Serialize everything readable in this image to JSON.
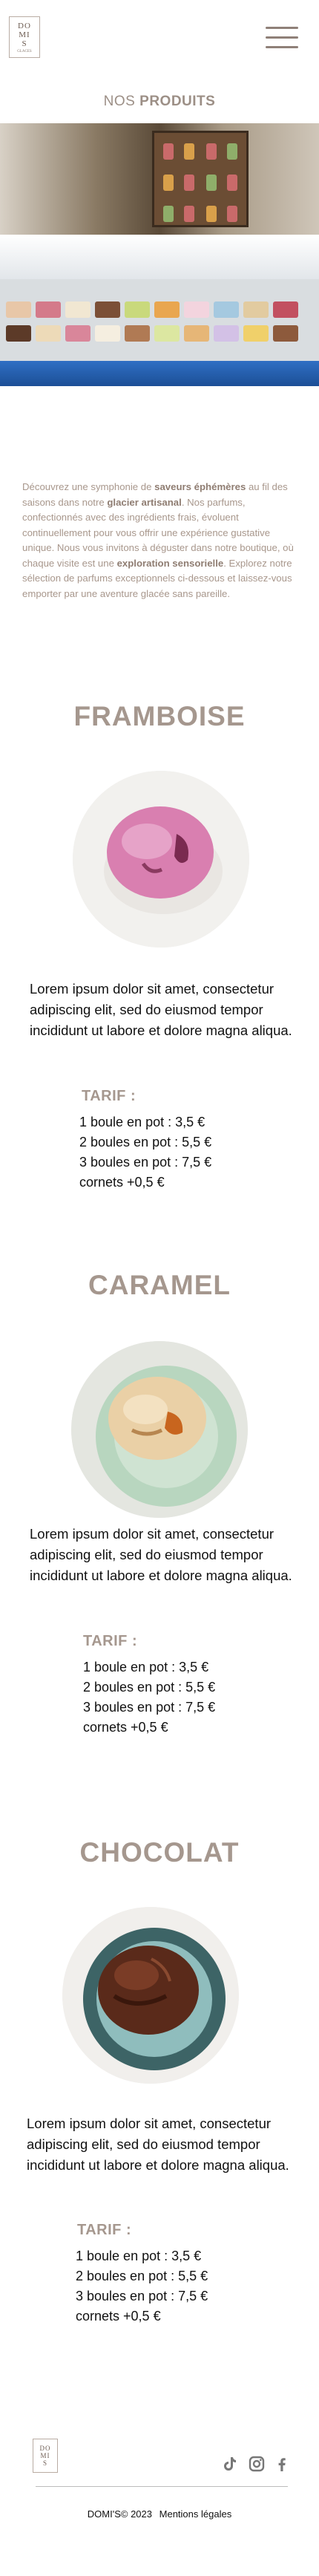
{
  "header": {
    "logo_text_1": "DO",
    "logo_text_2": "MI",
    "logo_text_3": "S",
    "logo_sub": "GLACES"
  },
  "section": {
    "title_light": "NOS",
    "title_bold": "PRODUITS"
  },
  "intro": [
    {
      "t": "Découvrez une symphonie de ",
      "b": false
    },
    {
      "t": "saveurs éphémères",
      "b": true
    },
    {
      "t": " au fil des saisons dans notre ",
      "b": false
    },
    {
      "t": "glacier artisanal",
      "b": true
    },
    {
      "t": ". Nos parfums, confectionnés avec des ingrédients frais, évoluent continuellement pour vous offrir une expérience gustative unique. Nous vous invitons à déguster dans notre boutique, où chaque visite est une ",
      "b": false
    },
    {
      "t": "exploration sensorielle",
      "b": true
    },
    {
      "t": ". Explorez notre sélection de parfums exceptionnels ci-dessous et laissez-vous emporter par une aventure glacée sans pareille.",
      "b": false
    }
  ],
  "products": [
    {
      "name": "FRAMBOISE",
      "description": "Lorem ipsum dolor sit amet, consectetur adipiscing elit, sed do eiusmod tempor incididunt ut labore et dolore magna aliqua.",
      "tarif_label": "TARIF :",
      "prices": [
        "1 boule en pot :  3,5 €",
        "2 boules en pot :  5,5 €",
        "3 boules en pot :  7,5 €",
        " cornets  +0,5 €"
      ]
    },
    {
      "name": "CARAMEL",
      "description": "Lorem ipsum dolor sit amet, consectetur adipiscing elit, sed do eiusmod tempor incididunt ut labore et dolore magna aliqua.",
      "tarif_label": "TARIF :",
      "prices": [
        "1 boule en pot :  3,5 €",
        "2 boules en pot :  5,5 €",
        "3 boules en pot :  7,5 €",
        " cornets  +0,5 €"
      ]
    },
    {
      "name": "CHOCOLAT",
      "description": "Lorem ipsum dolor sit amet, consectetur adipiscing elit, sed do eiusmod tempor incididunt ut labore et dolore magna aliqua.",
      "tarif_label": "TARIF :",
      "prices": [
        "1 boule en pot :  3,5 €",
        "2 boules en pot :  5,5 €",
        "3 boules en pot :  7,5 €",
        " cornets  +0,5 €"
      ]
    }
  ],
  "footer": {
    "logo_text_1": "DO",
    "logo_text_2": "MI",
    "logo_text_3": "S",
    "copyright": "DOMI'S© 2023",
    "legal_link": "Mentions légales",
    "social_icons": [
      "tiktok-icon",
      "instagram-icon",
      "facebook-icon"
    ]
  },
  "colors": {
    "accent": "#a5978e",
    "text": "#111111",
    "intro": "#a8978c"
  }
}
